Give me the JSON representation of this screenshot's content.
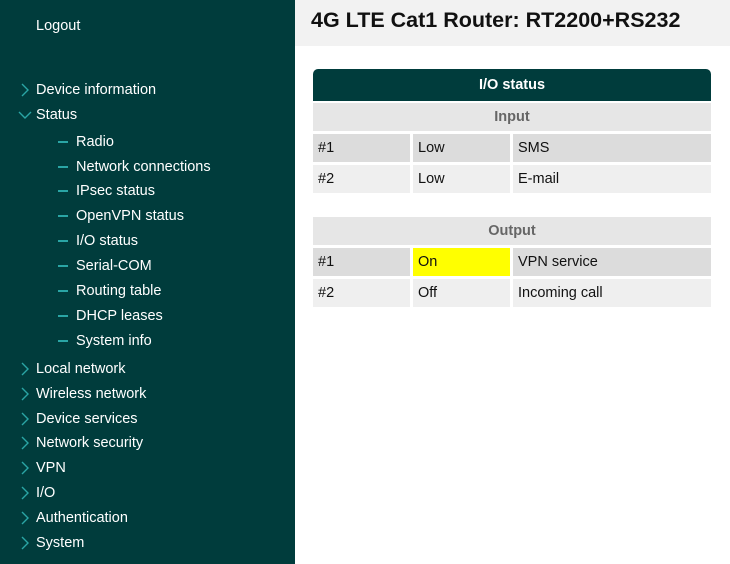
{
  "sidebar": {
    "logout": "Logout",
    "sections": [
      {
        "label": "Device information",
        "expanded": false
      },
      {
        "label": "Status",
        "expanded": true
      },
      {
        "label": "Local network",
        "expanded": false
      },
      {
        "label": "Wireless network",
        "expanded": false
      },
      {
        "label": "Device services",
        "expanded": false
      },
      {
        "label": "Network security",
        "expanded": false
      },
      {
        "label": "VPN",
        "expanded": false
      },
      {
        "label": "I/O",
        "expanded": false
      },
      {
        "label": "Authentication",
        "expanded": false
      },
      {
        "label": "System",
        "expanded": false
      }
    ],
    "status_items": [
      "Radio",
      "Network connections",
      "IPsec status",
      "OpenVPN status",
      "I/O status",
      "Serial-COM",
      "Routing table",
      "DHCP leases",
      "System info"
    ]
  },
  "header": {
    "title": "4G LTE Cat1 Router: RT2200+RS232"
  },
  "io": {
    "title": "I/O status",
    "input": {
      "heading": "Input",
      "rows": [
        {
          "id": "#1",
          "state": "Low",
          "action": "SMS"
        },
        {
          "id": "#2",
          "state": "Low",
          "action": "E-mail"
        }
      ]
    },
    "output": {
      "heading": "Output",
      "rows": [
        {
          "id": "#1",
          "state": "On",
          "action": "VPN service"
        },
        {
          "id": "#2",
          "state": "Off",
          "action": "Incoming call"
        }
      ]
    }
  },
  "colors": {
    "sidebar_bg": "#003c3c",
    "highlight": "#ffff00",
    "accent": "#2aa5a5"
  }
}
